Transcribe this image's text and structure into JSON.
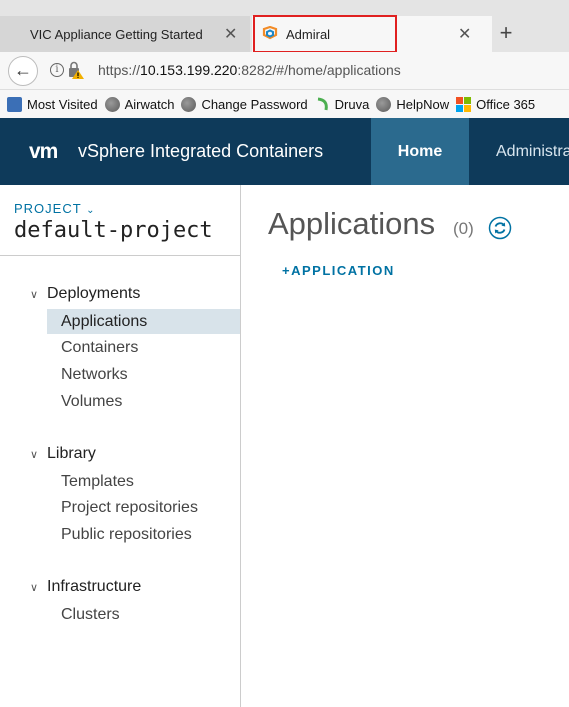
{
  "browser": {
    "tabs": [
      {
        "label": "VIC Appliance Getting Started"
      },
      {
        "label": "Admiral"
      }
    ],
    "url": {
      "scheme": "https://",
      "host": "10.153.199.220",
      "rest": ":8282/#/home/applications"
    },
    "bookmarks": [
      "Most Visited",
      "Airwatch",
      "Change Password",
      "Druva",
      "HelpNow",
      "Office 365"
    ]
  },
  "header": {
    "logo": "vm",
    "title": "vSphere Integrated Containers",
    "nav": {
      "home": "Home",
      "admin": "Administration"
    }
  },
  "sidebar": {
    "project_label": "PROJECT",
    "project_name": "default-project",
    "sections": [
      {
        "title": "Deployments",
        "items": [
          "Applications",
          "Containers",
          "Networks",
          "Volumes"
        ]
      },
      {
        "title": "Library",
        "items": [
          "Templates",
          "Project repositories",
          "Public repositories"
        ]
      },
      {
        "title": "Infrastructure",
        "items": [
          "Clusters"
        ]
      }
    ]
  },
  "main": {
    "title": "Applications",
    "count": "(0)",
    "add_label": "APPLICATION"
  },
  "colors": {
    "header_bg": "#0e3a5a",
    "nav_active": "#2b6a8e",
    "link": "#0072a3",
    "highlight": "#e02020"
  }
}
